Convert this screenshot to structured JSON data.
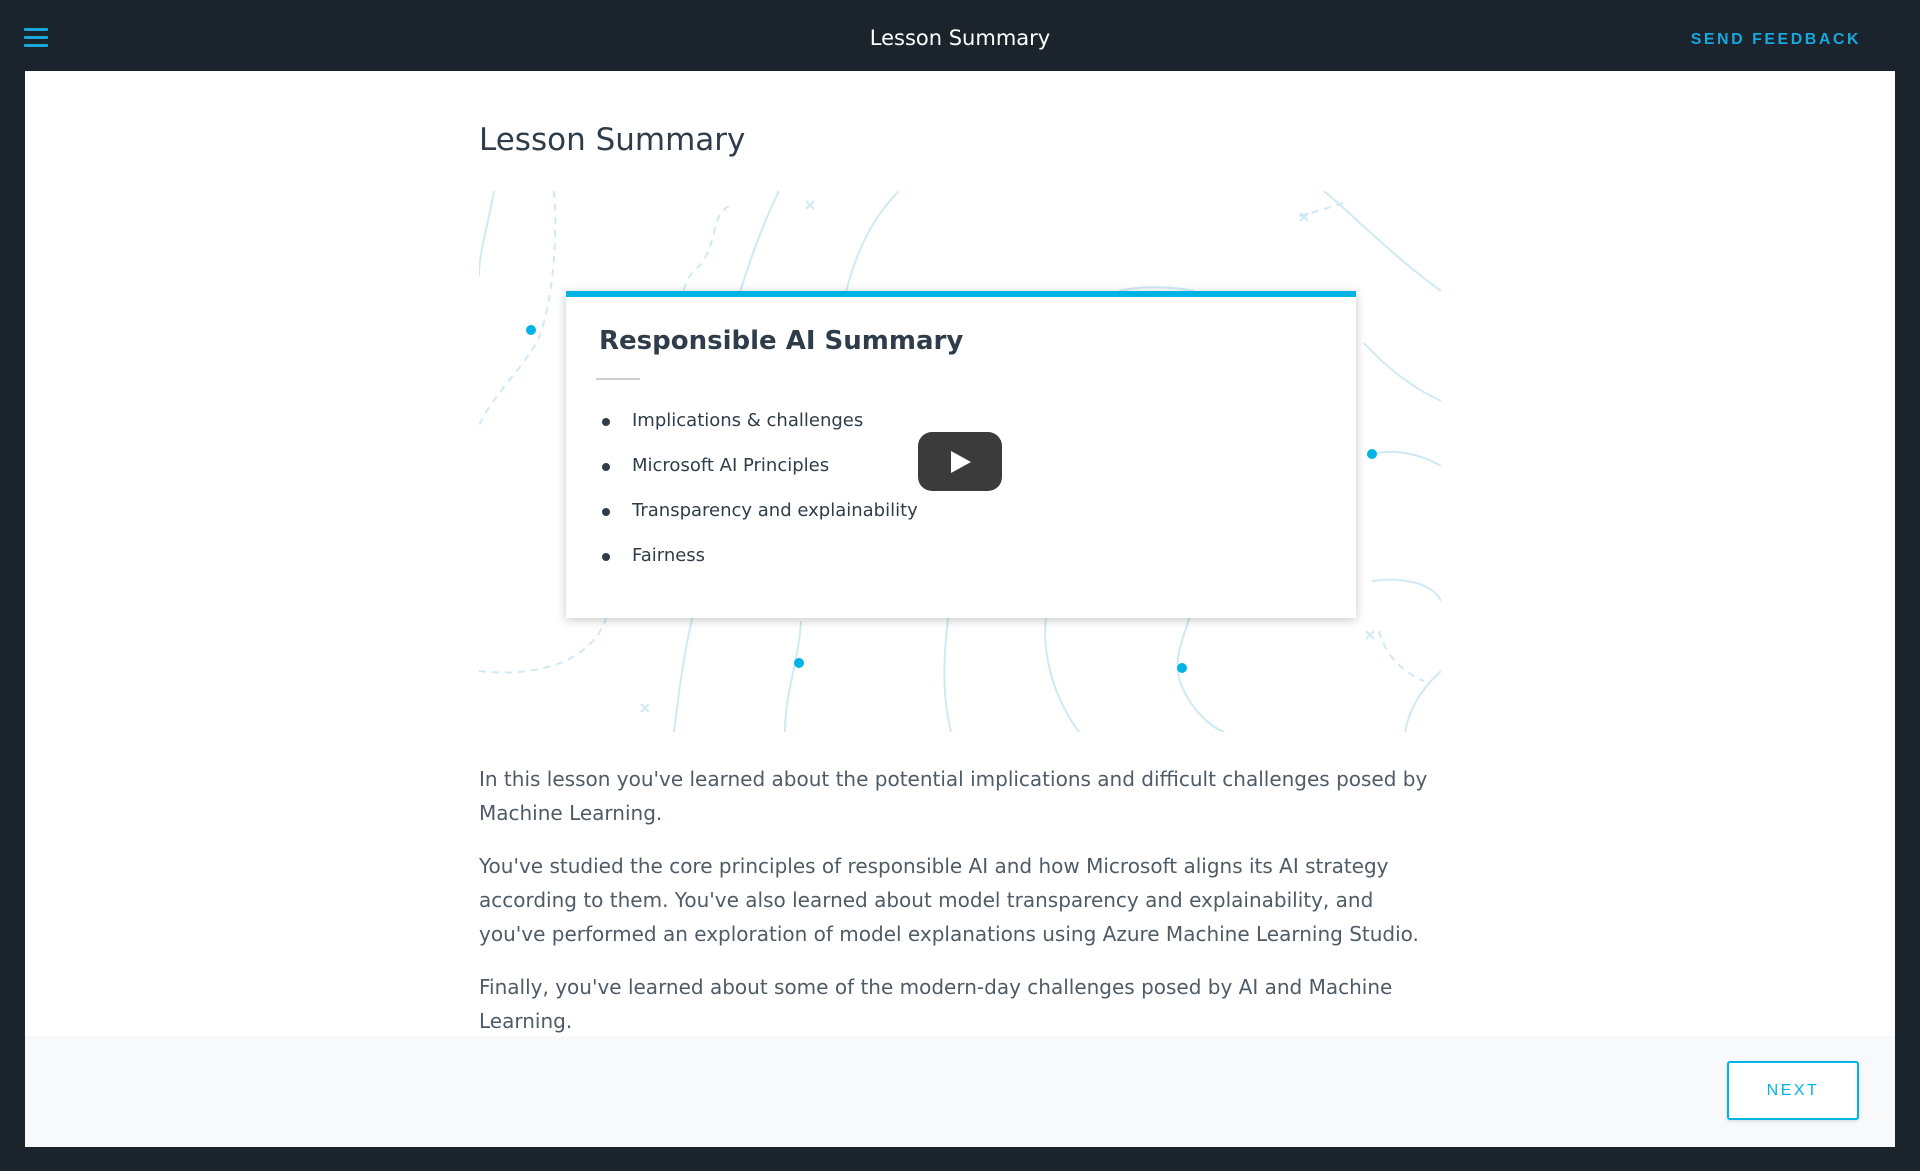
{
  "header": {
    "title": "Lesson Summary",
    "send_feedback_label": "SEND FEEDBACK",
    "menu_icon": "hamburger-menu-icon"
  },
  "main": {
    "page_title": "Lesson Summary",
    "video": {
      "slide_title": "Responsible AI Summary",
      "bullets": [
        "Implications & challenges",
        "Microsoft AI Principles",
        "Transparency and explainability",
        "Fairness"
      ],
      "play_icon": "play-icon"
    },
    "paragraphs": [
      "In this lesson you've learned about the potential implications and difficult challenges posed by Machine Learning.",
      "You've studied the core principles of responsible AI and how Microsoft aligns its AI strategy according to them. You've also learned about model transparency and explainability, and you've performed an exploration of model explanations using Azure Machine Learning Studio.",
      "Finally, you've learned about some of the modern-day challenges posed by AI and Machine Learning."
    ]
  },
  "footer": {
    "next_label": "NEXT"
  },
  "colors": {
    "accent": "#02b3e4",
    "dark_bg": "#1b242c",
    "text": "#2e3d49"
  }
}
